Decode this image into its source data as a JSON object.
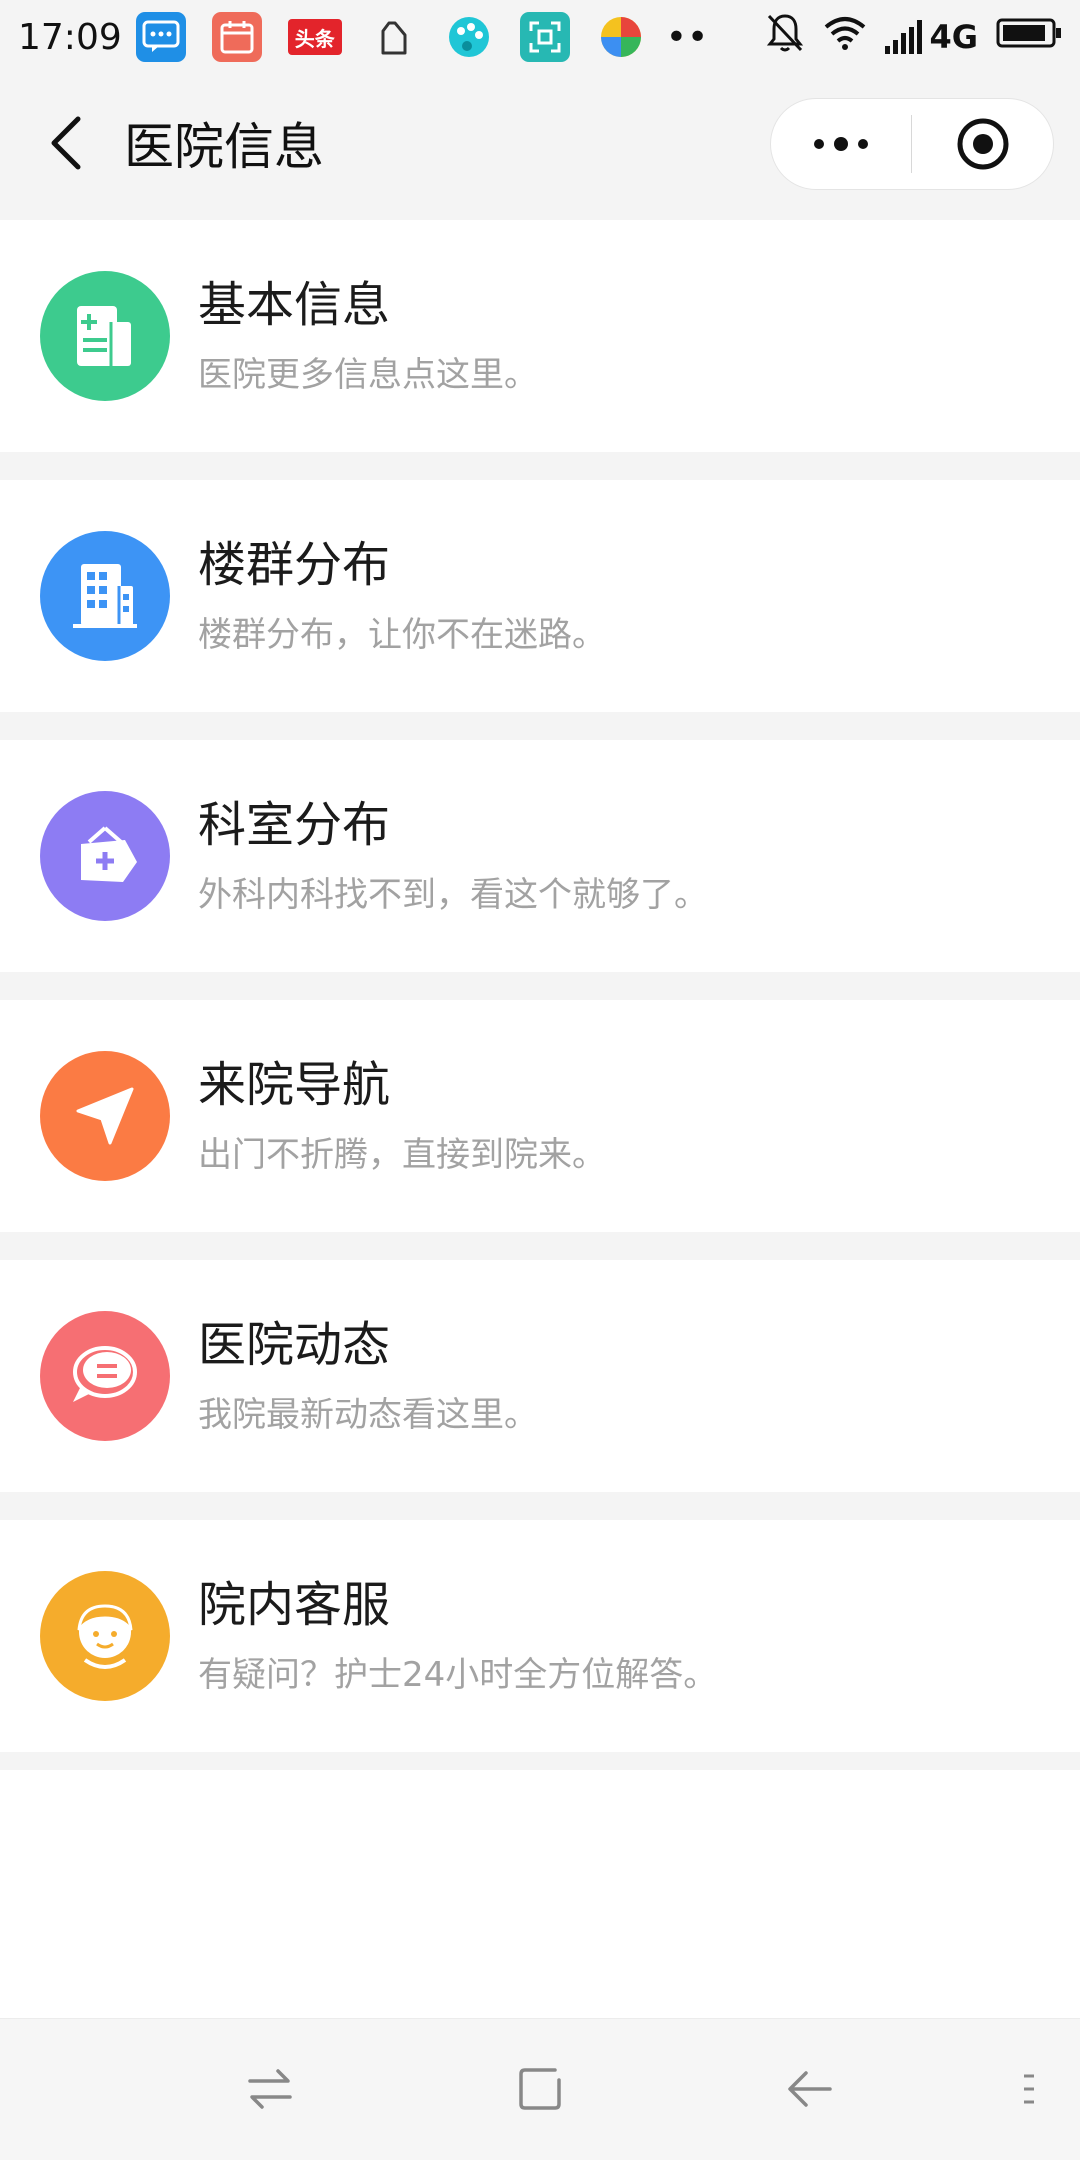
{
  "status_bar": {
    "time": "17:09",
    "app_icons": [
      "message-icon",
      "calendar-icon",
      "toutiao-icon",
      "clipboard-icon",
      "palette-icon",
      "scan-icon",
      "browser-icon"
    ],
    "toutiao_label": "头条",
    "more_notifications": "••",
    "network": "4G"
  },
  "nav": {
    "title": "医院信息"
  },
  "items": [
    {
      "title": "基本信息",
      "subtitle": "医院更多信息点这里。",
      "icon": "document-icon",
      "color": "#3dcb8e"
    },
    {
      "title": "楼群分布",
      "subtitle": "楼群分布，让你不在迷路。",
      "icon": "building-icon",
      "color": "#3d94f5"
    },
    {
      "title": "科室分布",
      "subtitle": "外科内科找不到，看这个就够了。",
      "icon": "medical-bag-icon",
      "color": "#8d7cf3"
    },
    {
      "title": "来院导航",
      "subtitle": "出门不折腾，直接到院来。",
      "icon": "navigation-arrow-icon",
      "color": "#fb7b44"
    },
    {
      "title": "医院动态",
      "subtitle": "我院最新动态看这里。",
      "icon": "chat-bubble-icon",
      "color": "#f66f73"
    },
    {
      "title": "院内客服",
      "subtitle": "有疑问？护士24小时全方位解答。",
      "icon": "nurse-icon",
      "color": "#f5ac2c"
    }
  ]
}
